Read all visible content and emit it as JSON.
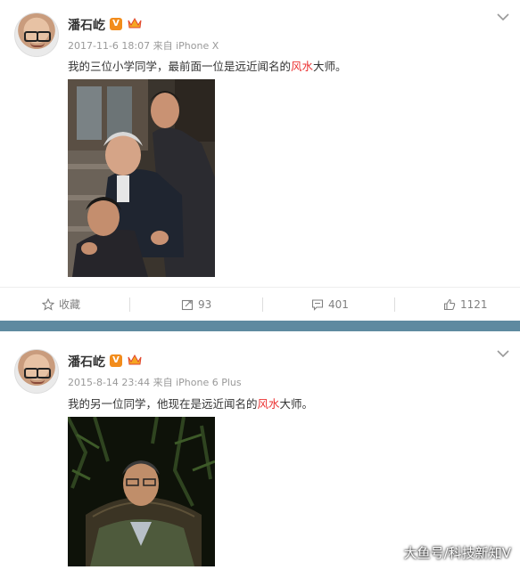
{
  "posts": [
    {
      "author": "潘石屹",
      "verified_badge": "V",
      "meta": "2017-11-6 18:07 来自 iPhone X",
      "text_before": "我的三位小学同学，最前面一位是远近闻名的",
      "text_highlight": "风水",
      "text_after": "大师。",
      "actions": {
        "favorite_label": "收藏",
        "repost_count": "93",
        "comment_count": "401",
        "like_count": "1121"
      }
    },
    {
      "author": "潘石屹",
      "verified_badge": "V",
      "meta": "2015-8-14 23:44 来自 iPhone 6 Plus",
      "text_before": "我的另一位同学，他现在是远近闻名的",
      "text_highlight": "风水",
      "text_after": "大师。"
    }
  ],
  "watermark": "大鱼号/科技新知V",
  "colors": {
    "highlight": "#eb3131",
    "separator": "#5e8aa0",
    "badge": "#f28c1c"
  }
}
